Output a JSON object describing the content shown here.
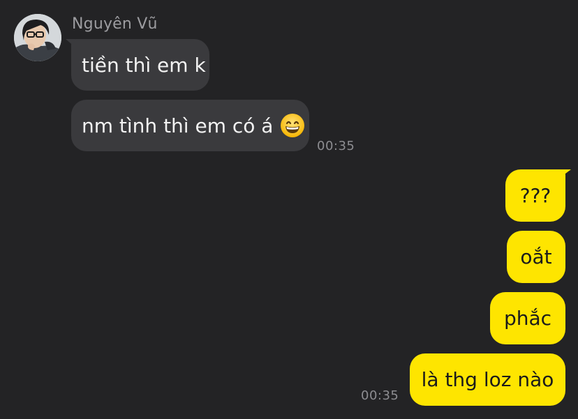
{
  "contact": {
    "name": "Nguyên Vũ",
    "avatar_icon": "profile-photo"
  },
  "messages": [
    {
      "side": "incoming",
      "text": "tiền thì em k"
    },
    {
      "side": "incoming",
      "text": "nm tình thì em có á",
      "emoji": "grinning-face-icon"
    },
    {
      "side": "outgoing",
      "text": "???"
    },
    {
      "side": "outgoing",
      "text": "oắt"
    },
    {
      "side": "outgoing",
      "text": "phắc"
    },
    {
      "side": "outgoing",
      "text": "là thg loz nào"
    }
  ],
  "timestamps": {
    "incoming_group": "00:35",
    "outgoing_group": "00:35"
  },
  "colors": {
    "background": "#232325",
    "incoming_bubble": "#3a3a3d",
    "outgoing_bubble": "#fee500",
    "name_text": "#9c9ca0",
    "time_text": "#8d8d91"
  }
}
